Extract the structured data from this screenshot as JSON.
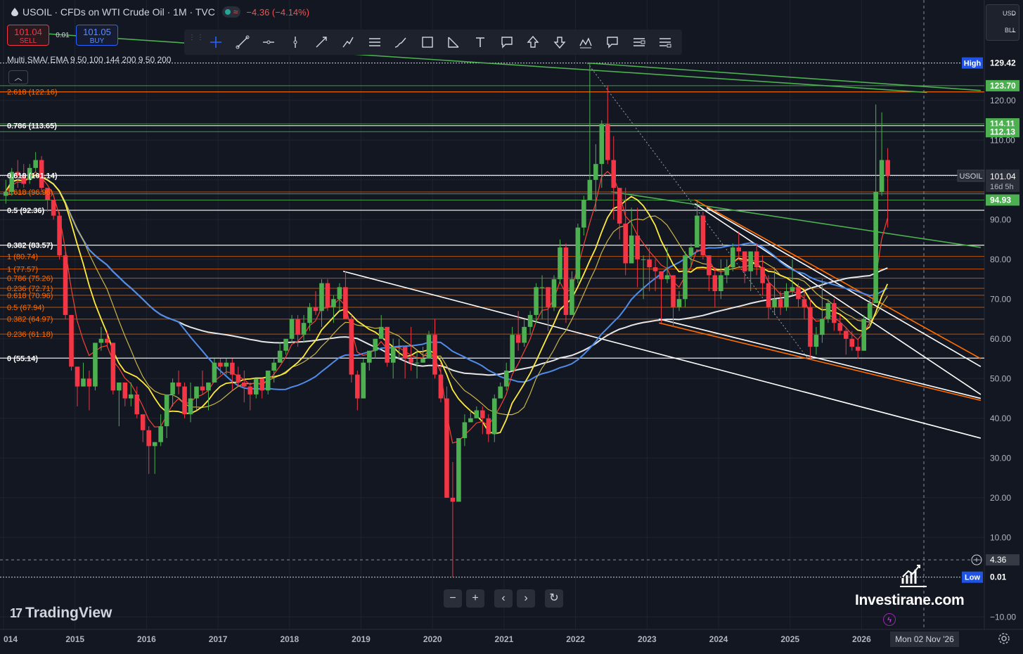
{
  "header": {
    "title": "USOIL · CFDs on WTI Crude Oil · 1M · TVC",
    "indicator_wave": "≈",
    "change": "−4.36 (−4.14%)"
  },
  "trade": {
    "sell_price": "101.04",
    "sell_label": "SELL",
    "spread": "0.01",
    "buy_price": "101.05",
    "buy_label": "BUY"
  },
  "indicator_label": "Multi SMA/ EMA 9 50 100 144 200 9 50 200",
  "currency": {
    "currency": "USD",
    "unit": "BLL"
  },
  "drawing_tools": [
    "crosshair-icon",
    "trend-line-icon",
    "horizontal-ray-icon",
    "vertical-line-icon",
    "arrow-line-icon",
    "path-icon",
    "parallel-channel-icon",
    "brush-icon",
    "rectangle-icon",
    "fib-icon",
    "text-icon",
    "callout-icon",
    "arrow-up-icon",
    "arrow-down-icon",
    "pattern-icon",
    "comment-icon",
    "long-position-icon",
    "short-position-icon"
  ],
  "nav_buttons": {
    "zoom_out": "−",
    "zoom_in": "+",
    "back": "‹",
    "forward": "›",
    "reset": "↻"
  },
  "branding": {
    "tradingview": "TradingView",
    "watermark": "Investirane.com"
  },
  "crosshair_date": "Mon 02 Nov '26",
  "colors": {
    "up": "#4caf50",
    "down": "#f23645",
    "ema9": "#f44336",
    "sma50": "#ffeb3b",
    "sma100": "#c9b44a",
    "sma200": "#4f8be8",
    "ema200": "#e6e6e6",
    "trend_green": "#4caf50",
    "trend_white": "#ffffff",
    "trend_orange": "#ff6d00"
  },
  "chart_data": {
    "type": "candlestick",
    "symbol": "USOIL",
    "interval": "1M",
    "x_ticks": [
      "014",
      "2015",
      "2016",
      "2017",
      "2018",
      "2019",
      "2020",
      "2021",
      "2022",
      "2023",
      "2024",
      "2025",
      "2026"
    ],
    "y_ticks": [
      "120.00",
      "110.00",
      "100.00",
      "90.00",
      "80.00",
      "70.00",
      "60.00",
      "50.00",
      "40.00",
      "30.00",
      "20.00",
      "10.00",
      "−10.00"
    ],
    "y_range": [
      -12,
      136
    ],
    "price_labels": [
      {
        "text": "High",
        "value": "129.42",
        "price": 129.42,
        "style": "ghost",
        "bg": "#1e53e5"
      },
      {
        "text": "",
        "value": "123.70",
        "price": 123.7,
        "style": "solid",
        "bg": "#4caf50"
      },
      {
        "text": "",
        "value": "114.11",
        "price": 114.11,
        "style": "solid",
        "bg": "#4caf50"
      },
      {
        "text": "",
        "value": "112.13",
        "price": 112.13,
        "style": "solid",
        "bg": "#4caf50"
      },
      {
        "text": "USOIL",
        "value": "101.04",
        "price": 101.04,
        "style": "current",
        "bg": "#ffffff",
        "sub": "16d 5h"
      },
      {
        "text": "",
        "value": "94.93",
        "price": 94.93,
        "style": "solid",
        "bg": "#4caf50"
      },
      {
        "text": "",
        "value": "4.36",
        "price": 4.36,
        "style": "cross",
        "bg": "#131722"
      },
      {
        "text": "Low",
        "value": "0.01",
        "price": 0.01,
        "style": "ghost",
        "bg": "#1e53e5"
      }
    ],
    "fib_upper": [
      {
        "text": "2.618 (122.16)",
        "price": 122.16,
        "color": "#ff6d00"
      },
      {
        "text": "0.786 (113.65)",
        "price": 113.65,
        "color": "#ffffff"
      },
      {
        "text": "0.618 (101.14)",
        "price": 101.14,
        "color": "#ffffff"
      },
      {
        "text": "0.5 (92.36)",
        "price": 92.36,
        "color": "#ffffff"
      },
      {
        "text": "0.382 (83.57)",
        "price": 83.57,
        "color": "#ffffff"
      },
      {
        "text": "0 (55.14)",
        "price": 55.14,
        "color": "#ffffff"
      }
    ],
    "fib_lower": [
      {
        "text": "1.618 (96.96)",
        "price": 96.96,
        "color": "#ff6d00"
      },
      {
        "text": "1 (80.74)",
        "price": 80.74,
        "color": "#ff6d00"
      },
      {
        "text": "1 (77.57)",
        "price": 77.57,
        "color": "#ff6d00"
      },
      {
        "text": "0.786 (75.26)",
        "price": 75.26,
        "color": "#ff6d00"
      },
      {
        "text": "0.236 (72.71)",
        "price": 72.71,
        "color": "#ff6d00"
      },
      {
        "text": "0.618 (70.96)",
        "price": 70.96,
        "color": "#ff6d00"
      },
      {
        "text": "0.5 (67.94)",
        "price": 67.94,
        "color": "#ff6d00"
      },
      {
        "text": "0.382 (64.97)",
        "price": 64.97,
        "color": "#ff6d00"
      },
      {
        "text": "0.236 (61.18)",
        "price": 61.18,
        "color": "#ff6d00"
      }
    ],
    "green_levels": [
      123.7,
      114.11,
      112.13,
      96.5,
      94.93
    ],
    "trendlines": [
      {
        "color": "#4caf50",
        "from": [
          "2014-06",
          137
        ],
        "to": [
          "2026-12",
          122
        ]
      },
      {
        "color": "#4caf50",
        "from": [
          "2022-03",
          129.42
        ],
        "to": [
          "2027-09",
          122.5
        ]
      },
      {
        "color": "#4caf50",
        "from": [
          "2022-07",
          97
        ],
        "to": [
          "2027-09",
          83
        ]
      },
      {
        "color": "#ffffff",
        "from": [
          "2018-10",
          77
        ],
        "to": [
          "2027-09",
          35
        ]
      },
      {
        "color": "#ffffff",
        "from": [
          "2023-09",
          94
        ],
        "to": [
          "2027-09",
          46
        ]
      },
      {
        "color": "#ffffff",
        "from": [
          "2023-11",
          93
        ],
        "to": [
          "2027-09",
          53
        ]
      },
      {
        "color": "#ff6d00",
        "from": [
          "2023-09",
          95
        ],
        "to": [
          "2027-09",
          55
        ]
      },
      {
        "color": "#ff6d00",
        "from": [
          "2023-03",
          64
        ],
        "to": [
          "2027-09",
          44.5
        ]
      },
      {
        "color": "#ffffff",
        "from": [
          "2023-03",
          65
        ],
        "to": [
          "2027-09",
          45
        ]
      }
    ],
    "candles": [
      [
        "2014-01",
        96,
        100,
        94,
        97
      ],
      [
        "2014-02",
        97,
        103,
        96,
        102
      ],
      [
        "2014-03",
        102,
        105,
        98,
        101
      ],
      [
        "2014-04",
        101,
        104,
        98,
        99
      ],
      [
        "2014-05",
        100,
        104,
        99,
        103
      ],
      [
        "2014-06",
        103,
        107,
        102,
        105
      ],
      [
        "2014-07",
        105,
        106,
        97,
        98
      ],
      [
        "2014-08",
        98,
        98,
        92,
        95
      ],
      [
        "2014-09",
        95,
        95,
        90,
        91
      ],
      [
        "2014-10",
        91,
        92,
        80,
        81
      ],
      [
        "2014-11",
        81,
        82,
        65,
        66
      ],
      [
        "2014-12",
        66,
        66,
        52,
        53
      ],
      [
        "2015-01",
        53,
        53,
        43,
        48
      ],
      [
        "2015-02",
        48,
        54,
        48,
        50
      ],
      [
        "2015-03",
        50,
        52,
        42,
        48
      ],
      [
        "2015-04",
        48,
        59,
        47,
        59
      ],
      [
        "2015-05",
        59,
        63,
        57,
        60
      ],
      [
        "2015-06",
        60,
        62,
        58,
        59
      ],
      [
        "2015-07",
        59,
        59,
        46,
        47
      ],
      [
        "2015-08",
        47,
        49,
        38,
        49
      ],
      [
        "2015-09",
        49,
        49,
        43,
        45
      ],
      [
        "2015-10",
        45,
        49,
        43,
        46
      ],
      [
        "2015-11",
        46,
        48,
        40,
        41
      ],
      [
        "2015-12",
        41,
        41,
        34,
        37
      ],
      [
        "2016-01",
        37,
        38,
        26,
        33
      ],
      [
        "2016-02",
        33,
        34,
        26,
        34
      ],
      [
        "2016-03",
        34,
        41,
        33,
        38
      ],
      [
        "2016-04",
        38,
        46,
        35,
        46
      ],
      [
        "2016-05",
        46,
        50,
        43,
        49
      ],
      [
        "2016-06",
        49,
        52,
        46,
        48
      ],
      [
        "2016-07",
        48,
        49,
        40,
        41
      ],
      [
        "2016-08",
        41,
        49,
        39,
        45
      ],
      [
        "2016-09",
        45,
        48,
        42,
        48
      ],
      [
        "2016-10",
        48,
        52,
        46,
        47
      ],
      [
        "2016-11",
        47,
        49,
        42,
        49
      ],
      [
        "2016-12",
        49,
        55,
        49,
        54
      ],
      [
        "2017-01",
        54,
        55,
        51,
        53
      ],
      [
        "2017-02",
        53,
        55,
        51,
        54
      ],
      [
        "2017-03",
        54,
        55,
        47,
        51
      ],
      [
        "2017-04",
        51,
        53,
        48,
        49
      ],
      [
        "2017-05",
        49,
        52,
        44,
        48
      ],
      [
        "2017-06",
        48,
        49,
        42,
        46
      ],
      [
        "2017-07",
        46,
        50,
        45,
        50
      ],
      [
        "2017-08",
        50,
        50,
        45,
        47
      ],
      [
        "2017-09",
        47,
        52,
        46,
        52
      ],
      [
        "2017-10",
        52,
        55,
        49,
        54
      ],
      [
        "2017-11",
        54,
        59,
        54,
        57
      ],
      [
        "2017-12",
        57,
        60,
        56,
        60
      ],
      [
        "2018-01",
        60,
        66,
        59,
        65
      ],
      [
        "2018-02",
        65,
        66,
        58,
        61
      ],
      [
        "2018-03",
        61,
        66,
        59,
        64
      ],
      [
        "2018-04",
        64,
        69,
        62,
        68
      ],
      [
        "2018-05",
        68,
        72,
        66,
        67
      ],
      [
        "2018-06",
        67,
        75,
        63,
        74
      ],
      [
        "2018-07",
        74,
        75,
        67,
        68
      ],
      [
        "2018-08",
        68,
        71,
        64,
        70
      ],
      [
        "2018-09",
        70,
        74,
        67,
        73
      ],
      [
        "2018-10",
        73,
        77,
        65,
        65
      ],
      [
        "2018-11",
        65,
        66,
        49,
        51
      ],
      [
        "2018-12",
        51,
        52,
        42,
        45
      ],
      [
        "2019-01",
        45,
        55,
        45,
        54
      ],
      [
        "2019-02",
        54,
        57,
        52,
        57
      ],
      [
        "2019-03",
        57,
        60,
        55,
        60
      ],
      [
        "2019-04",
        60,
        66,
        60,
        63
      ],
      [
        "2019-05",
        63,
        63,
        53,
        54
      ],
      [
        "2019-06",
        54,
        60,
        50,
        58
      ],
      [
        "2019-07",
        58,
        60,
        55,
        58
      ],
      [
        "2019-08",
        58,
        58,
        50,
        55
      ],
      [
        "2019-09",
        55,
        63,
        52,
        54
      ],
      [
        "2019-10",
        54,
        57,
        50,
        54
      ],
      [
        "2019-11",
        54,
        58,
        54,
        55
      ],
      [
        "2019-12",
        55,
        62,
        55,
        61
      ],
      [
        "2020-01",
        61,
        65,
        50,
        51
      ],
      [
        "2020-02",
        51,
        54,
        44,
        45
      ],
      [
        "2020-03",
        45,
        48,
        20,
        20
      ],
      [
        "2020-04",
        20,
        29,
        0.01,
        19
      ],
      [
        "2020-05",
        19,
        35,
        19,
        35
      ],
      [
        "2020-06",
        35,
        41,
        33,
        39
      ],
      [
        "2020-07",
        39,
        42,
        39,
        40
      ],
      [
        "2020-08",
        40,
        43,
        40,
        42
      ],
      [
        "2020-09",
        42,
        43,
        36,
        40
      ],
      [
        "2020-10",
        40,
        41,
        34,
        36
      ],
      [
        "2020-11",
        36,
        46,
        34,
        45
      ],
      [
        "2020-12",
        45,
        49,
        45,
        48
      ],
      [
        "2021-01",
        48,
        54,
        47,
        52
      ],
      [
        "2021-02",
        52,
        63,
        52,
        61
      ],
      [
        "2021-03",
        61,
        67,
        57,
        59
      ],
      [
        "2021-04",
        59,
        65,
        58,
        63
      ],
      [
        "2021-05",
        63,
        67,
        61,
        66
      ],
      [
        "2021-06",
        66,
        74,
        64,
        73
      ],
      [
        "2021-07",
        73,
        76,
        65,
        73
      ],
      [
        "2021-08",
        73,
        73,
        62,
        68
      ],
      [
        "2021-09",
        68,
        76,
        67,
        75
      ],
      [
        "2021-10",
        75,
        85,
        74,
        83
      ],
      [
        "2021-11",
        83,
        84,
        64,
        66
      ],
      [
        "2021-12",
        66,
        77,
        66,
        75
      ],
      [
        "2022-01",
        75,
        89,
        74,
        88
      ],
      [
        "2022-02",
        88,
        96,
        86,
        95
      ],
      [
        "2022-03",
        95,
        129.42,
        95,
        100
      ],
      [
        "2022-04",
        100,
        109,
        92,
        104
      ],
      [
        "2022-05",
        104,
        115,
        98,
        114
      ],
      [
        "2022-06",
        114,
        123.7,
        104,
        105
      ],
      [
        "2022-07",
        105,
        111,
        90,
        98
      ],
      [
        "2022-08",
        98,
        98,
        85,
        89
      ],
      [
        "2022-09",
        89,
        98,
        76,
        79
      ],
      [
        "2022-10",
        79,
        93,
        79,
        86
      ],
      [
        "2022-11",
        86,
        93,
        73,
        80
      ],
      [
        "2022-12",
        80,
        81,
        70,
        80
      ],
      [
        "2023-01",
        80,
        83,
        72,
        78
      ],
      [
        "2023-02",
        78,
        80,
        72,
        77
      ],
      [
        "2023-03",
        77,
        77,
        64,
        75
      ],
      [
        "2023-04",
        75,
        83,
        74,
        76
      ],
      [
        "2023-05",
        76,
        76,
        63,
        68
      ],
      [
        "2023-06",
        68,
        72,
        67,
        70
      ],
      [
        "2023-07",
        70,
        82,
        68,
        81
      ],
      [
        "2023-08",
        81,
        84,
        78,
        83
      ],
      [
        "2023-09",
        83,
        95,
        83,
        91
      ],
      [
        "2023-10",
        91,
        92,
        80,
        81
      ],
      [
        "2023-11",
        81,
        80,
        72,
        76
      ],
      [
        "2023-12",
        76,
        78,
        68,
        72
      ],
      [
        "2024-01",
        72,
        80,
        70,
        76
      ],
      [
        "2024-02",
        76,
        80,
        74,
        78
      ],
      [
        "2024-03",
        78,
        84,
        77,
        83
      ],
      [
        "2024-04",
        83,
        87,
        80,
        82
      ],
      [
        "2024-05",
        82,
        82,
        74,
        77
      ],
      [
        "2024-06",
        77,
        82,
        72,
        82
      ],
      [
        "2024-07",
        82,
        84,
        76,
        78
      ],
      [
        "2024-08",
        78,
        81,
        71,
        74
      ],
      [
        "2024-09",
        74,
        76,
        65,
        68
      ],
      [
        "2024-10",
        68,
        78,
        66,
        70
      ],
      [
        "2024-11",
        70,
        72,
        66,
        68
      ],
      [
        "2024-12",
        68,
        74,
        67,
        72
      ],
      [
        "2025-01",
        72,
        80,
        71,
        73
      ],
      [
        "2025-02",
        73,
        74,
        68,
        70
      ],
      [
        "2025-03",
        70,
        72,
        65,
        68
      ],
      [
        "2025-04",
        68,
        70,
        55,
        58
      ],
      [
        "2025-05",
        58,
        63,
        56,
        61
      ],
      [
        "2025-06",
        61,
        75,
        59,
        65
      ],
      [
        "2025-07",
        65,
        70,
        64,
        69
      ],
      [
        "2025-08",
        69,
        70,
        62,
        64
      ],
      [
        "2025-09",
        64,
        66,
        61,
        62
      ],
      [
        "2025-10",
        62,
        63,
        56,
        60
      ],
      [
        "2025-11",
        60,
        62,
        57,
        58
      ],
      [
        "2025-12",
        58,
        60,
        55,
        57
      ],
      [
        "2026-01",
        57,
        66,
        57,
        65
      ],
      [
        "2026-02",
        65,
        70,
        63,
        69
      ],
      [
        "2026-03",
        69,
        119,
        73,
        97
      ],
      [
        "2026-04",
        97,
        117,
        96,
        105
      ],
      [
        "2026-05",
        105,
        108,
        88,
        101.04
      ]
    ]
  }
}
